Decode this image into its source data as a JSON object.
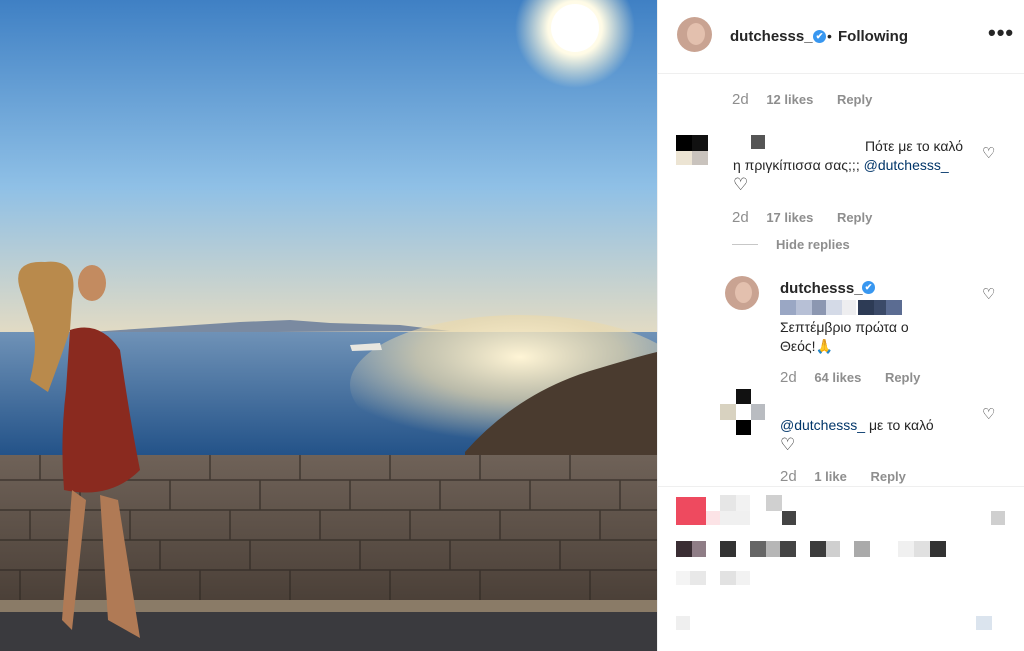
{
  "post": {
    "username": "dutchesss_",
    "verified_badge": "✔",
    "separator": "•",
    "follow_status": "Following",
    "more_icon": "•••"
  },
  "comments": [
    {
      "time": "2d",
      "likes": "12 likes",
      "reply": "Reply"
    },
    {
      "text_line1": "Πότε με το καλό",
      "text_line2": "η πριγκίπισσα σας;;;",
      "mention": "@dutchesss_",
      "heart_emoji": "♡",
      "time": "2d",
      "likes": "17 likes",
      "reply": "Reply",
      "hide_replies": "Hide replies"
    }
  ],
  "replies": [
    {
      "username": "dutchesss_",
      "verified_badge": "✔",
      "text_line1": "Σεπτέμβριο πρώτα ο",
      "text_line2": "Θεός!🙏",
      "time": "2d",
      "likes": "64 likes",
      "reply": "Reply"
    },
    {
      "mention": "@dutchesss_",
      "text": "με το καλό",
      "heart_emoji": "♡",
      "time": "2d",
      "likes": "1 like",
      "reply": "Reply"
    }
  ],
  "icons": {
    "like": "♡"
  },
  "colors": {
    "link": "#003569",
    "meta": "#8e8e8e",
    "verified": "#3897f0",
    "text": "#262626"
  }
}
